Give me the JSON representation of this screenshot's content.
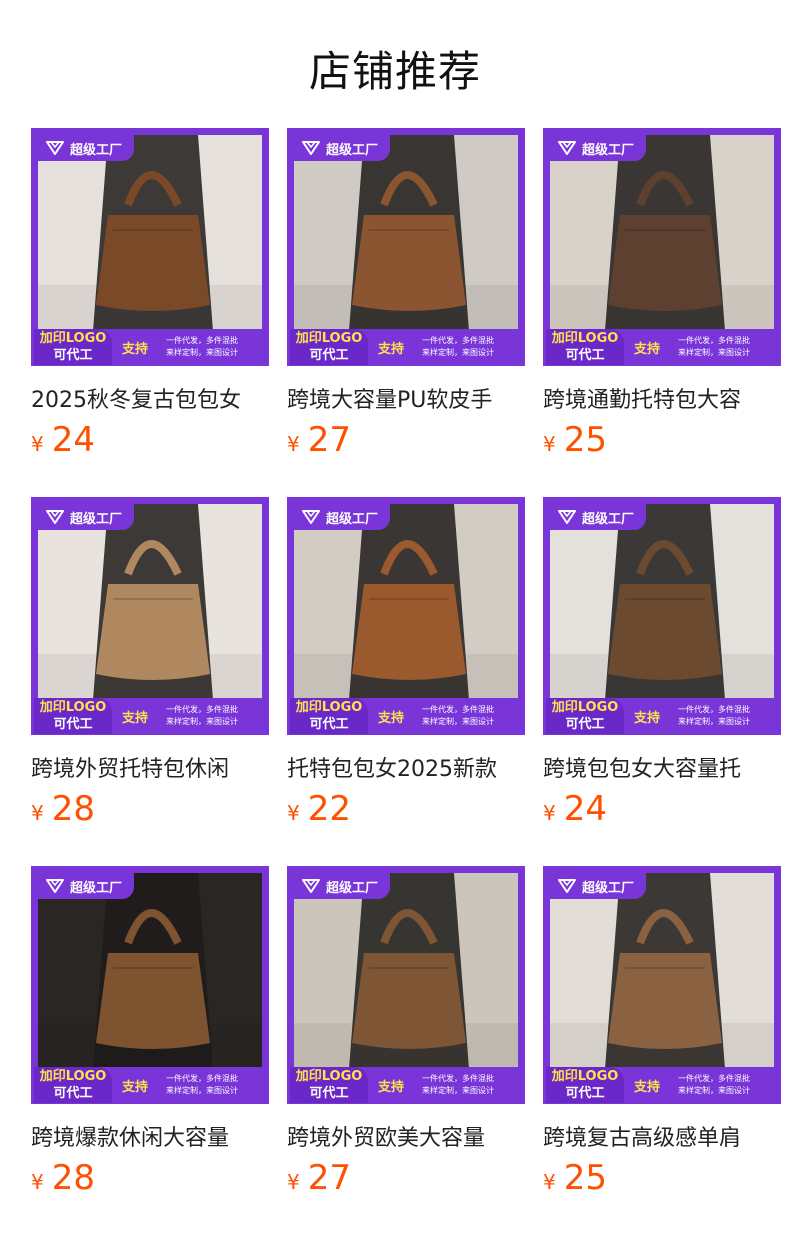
{
  "page": {
    "title": "店铺推荐"
  },
  "badge": {
    "top_label": "超级工厂",
    "logo_line1": "加印LOGO",
    "logo_line2": "可代工",
    "support_label": "支持",
    "small_line1": "一件代发，多件混批",
    "small_line2": "来样定制，来图设计"
  },
  "colors": {
    "accent": "#7a35d8",
    "price": "#ff5000",
    "highlight": "#ffe14a"
  },
  "products": [
    {
      "name": "2025秋冬复古包包女",
      "currency": "¥",
      "price": "24",
      "bag": "#7a4a28",
      "bg": "#e6e1dc"
    },
    {
      "name": "跨境大容量PU软皮手",
      "currency": "¥",
      "price": "27",
      "bag": "#8a5530",
      "bg": "#cfcac3"
    },
    {
      "name": "跨境通勤托特包大容",
      "currency": "¥",
      "price": "25",
      "bag": "#5e4030",
      "bg": "#d8d2ca"
    },
    {
      "name": "跨境外贸托特包休闲",
      "currency": "¥",
      "price": "28",
      "bag": "#b08860",
      "bg": "#e8e3dd"
    },
    {
      "name": "托特包包女2025新款",
      "currency": "¥",
      "price": "22",
      "bag": "#9a5a2e",
      "bg": "#d3ccc4"
    },
    {
      "name": "跨境包包女大容量托",
      "currency": "¥",
      "price": "24",
      "bag": "#6b4a30",
      "bg": "#e4e1dc"
    },
    {
      "name": "跨境爆款休闲大容量",
      "currency": "¥",
      "price": "28",
      "bag": "#7d5330",
      "bg": "#2a2623"
    },
    {
      "name": "跨境外贸欧美大容量",
      "currency": "¥",
      "price": "27",
      "bag": "#7e5535",
      "bg": "#cbc5bc"
    },
    {
      "name": "跨境复古高级感单肩",
      "currency": "¥",
      "price": "25",
      "bag": "#8a6242",
      "bg": "#e2ddd6"
    }
  ]
}
